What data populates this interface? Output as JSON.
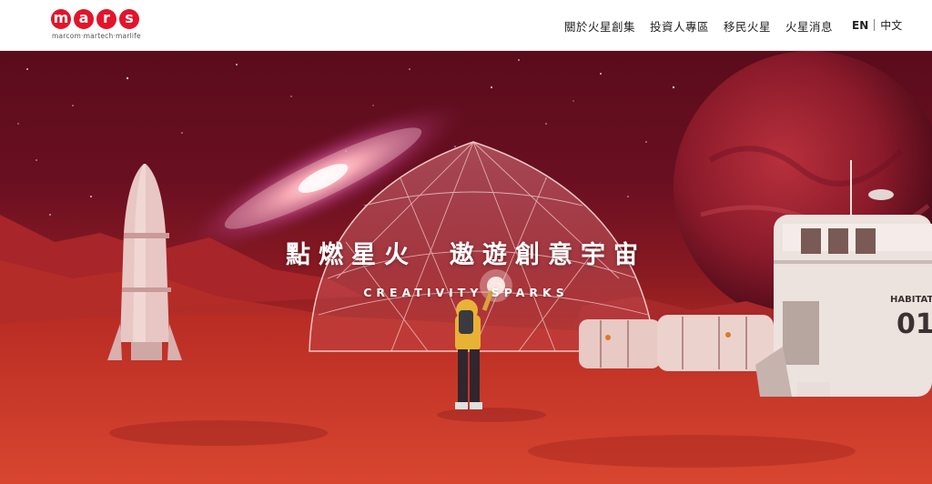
{
  "header": {
    "logo": {
      "letters": [
        "m",
        "a",
        "r",
        "s"
      ],
      "tagline": "marcom·martech·marlife"
    },
    "nav": [
      {
        "label": "關於火星創集"
      },
      {
        "label": "投資人專區"
      },
      {
        "label": "移民火星"
      },
      {
        "label": "火星消息"
      }
    ],
    "lang": {
      "en": "EN",
      "zh": "中文"
    }
  },
  "hero": {
    "title": "點燃星火　遨遊創意宇宙",
    "subtitle": "CREATIVITY SPARKS",
    "habitat_label_top": "HABITAT",
    "habitat_number": "01"
  },
  "colors": {
    "brand_red": "#e3142a",
    "sky": "#6a0f22",
    "ground": "#c53526"
  }
}
